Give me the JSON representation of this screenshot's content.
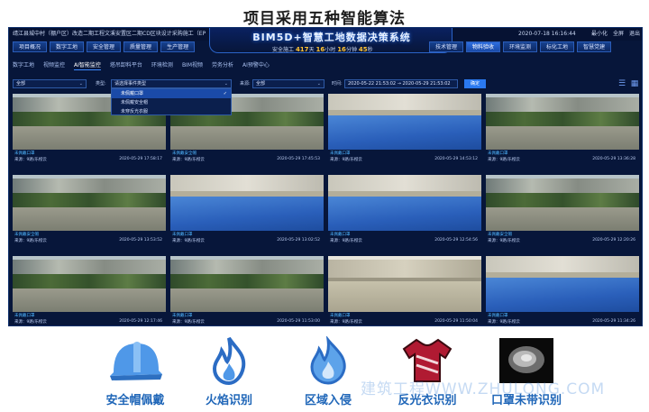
{
  "slide_title": "项目采用五种智能算法",
  "app": {
    "project_name": "靖江县城中村（棚户区）改造二期工程文溪安置区二期CD区块设计采购施工（EP",
    "datetime": "2020-07-18 16:16:44",
    "window_controls": [
      "最小化",
      "全屏",
      "退出"
    ],
    "system_title": "BIM5D+智慧工地数据决策系统",
    "safety": {
      "prefix": "安全施工",
      "days": "417",
      "days_unit": "天",
      "hours": "16",
      "hours_unit": "小时",
      "minutes": "16",
      "minutes_unit": "分钟",
      "seconds": "45",
      "seconds_unit": "秒"
    },
    "nav_left": [
      "项目概况",
      "数字工地",
      "安全管理",
      "质量管理",
      "生产管理"
    ],
    "nav_right": [
      "技术管理",
      "物料验收",
      "环境监测",
      "标化工地",
      "智慧党建"
    ],
    "nav_right_active": 1,
    "subnav": [
      "数字工地",
      "视频监控",
      "AI智能监控",
      "塔吊卸料平台",
      "环境检测",
      "BIM视频",
      "劳务分析",
      "AI预警中心"
    ],
    "subnav_active": 2,
    "filters": {
      "select1": "全部",
      "type_label": "类型:",
      "type_placeholder": "请选择事件类型",
      "source_label": "来源:",
      "source_value": "全部",
      "time_label": "时间:",
      "start": "2020-05-22 21:53:02",
      "sep": "→",
      "end": "2020-05-29 21:53:02",
      "query": "确定"
    },
    "dropdown": [
      "未佩戴口罩",
      "未佩戴安全帽",
      "未穿反光衣服"
    ],
    "dropdown_selected": 0,
    "cells": [
      {
        "tag": "未佩戴口罩",
        "src": "来源：9路/乐橙云",
        "time": "2020-05-29 17:58:17",
        "scene": "site"
      },
      {
        "tag": "未佩戴安全帽",
        "src": "来源：9路/乐橙云",
        "time": "2020-05-29 17:45:53",
        "scene": "site"
      },
      {
        "tag": "未佩戴口罩",
        "src": "来源：9路/乐橙云",
        "time": "2020-05-29 14:53:12",
        "scene": "roof"
      },
      {
        "tag": "未佩戴口罩",
        "src": "来源：9路/乐橙云",
        "time": "2020-05-29 13:36:28",
        "scene": "site"
      },
      {
        "tag": "未佩戴安全帽",
        "src": "来源：9路/乐橙云",
        "time": "2020-05-29 13:53:52",
        "scene": "site"
      },
      {
        "tag": "未佩戴口罩",
        "src": "来源：9路/乐橙云",
        "time": "2020-05-29 13:02:52",
        "scene": "roof"
      },
      {
        "tag": "未佩戴口罩",
        "src": "来源：9路/乐橙云",
        "time": "2020-05-29 12:54:56",
        "scene": "roof"
      },
      {
        "tag": "未佩戴安全帽",
        "src": "来源：9路/乐橙云",
        "time": "2020-05-29 12:20:26",
        "scene": "site"
      },
      {
        "tag": "未佩戴口罩",
        "src": "来源：9路/乐橙云",
        "time": "2020-05-29 12:17:46",
        "scene": "site"
      },
      {
        "tag": "未佩戴口罩",
        "src": "来源：9路/乐橙云",
        "time": "2020-05-29 11:53:00",
        "scene": "site"
      },
      {
        "tag": "未佩戴口罩",
        "src": "来源：9路/乐橙云",
        "time": "2020-05-29 11:50:04",
        "scene": "yard"
      },
      {
        "tag": "未佩戴口罩",
        "src": "来源：9路/乐橙云",
        "time": "2020-05-29 11:34:26",
        "scene": "roof"
      }
    ]
  },
  "algorithms": [
    {
      "label": "安全帽佩戴",
      "icon": "helmet-icon"
    },
    {
      "label": "火焰识别",
      "icon": "flame-icon"
    },
    {
      "label": "区域入侵",
      "icon": "intrusion-icon"
    },
    {
      "label": "反光衣识别",
      "icon": "reflective-vest-icon"
    },
    {
      "label": "口罩未带识别",
      "icon": "mask-icon"
    }
  ],
  "watermark": "建筑工程WWW.ZHULONG.COM"
}
